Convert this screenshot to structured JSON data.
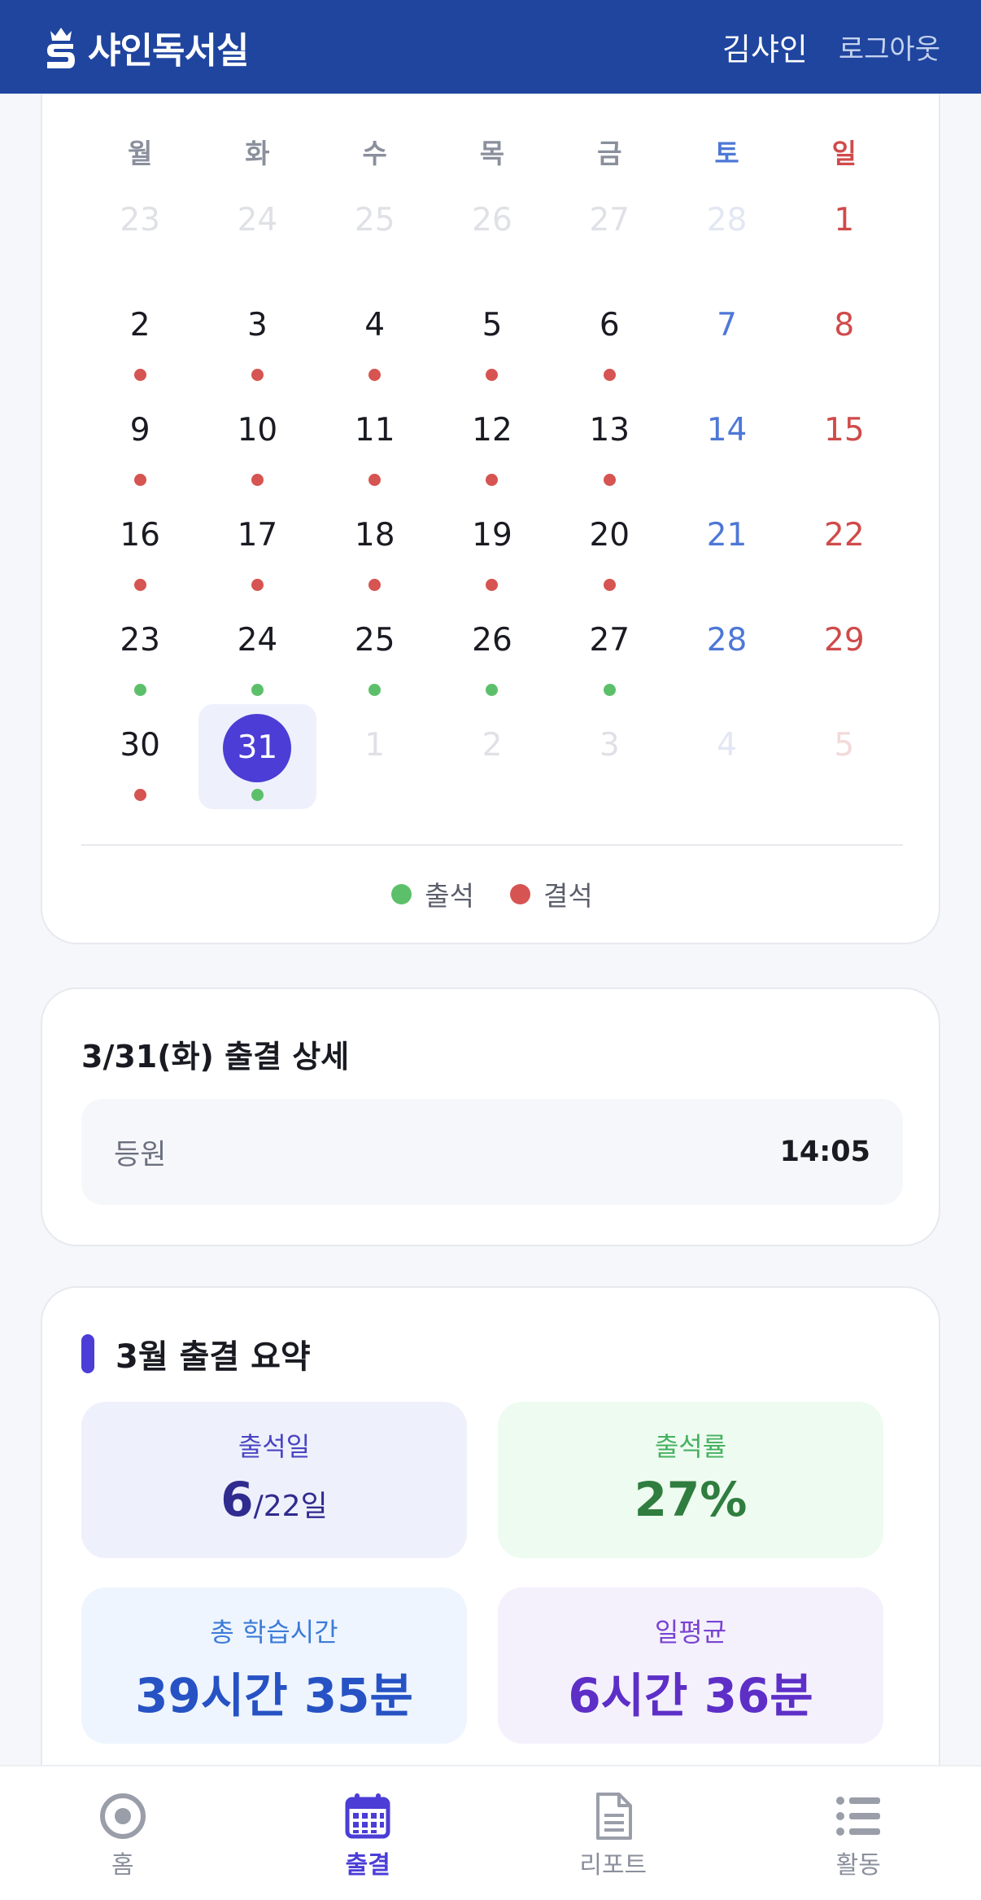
{
  "header": {
    "app_name": "샤인독서실",
    "user_name": "김샤인",
    "logout_label": "로그아웃"
  },
  "calendar": {
    "weekdays": [
      "월",
      "화",
      "수",
      "목",
      "금",
      "토",
      "일"
    ],
    "weeks": [
      [
        {
          "d": "23",
          "m": true
        },
        {
          "d": "24",
          "m": true
        },
        {
          "d": "25",
          "m": true
        },
        {
          "d": "26",
          "m": true
        },
        {
          "d": "27",
          "m": true
        },
        {
          "d": "28",
          "m": true
        },
        {
          "d": "1",
          "s": ""
        }
      ],
      [
        {
          "d": "2",
          "s": "absent"
        },
        {
          "d": "3",
          "s": "absent"
        },
        {
          "d": "4",
          "s": "absent"
        },
        {
          "d": "5",
          "s": "absent"
        },
        {
          "d": "6",
          "s": "absent"
        },
        {
          "d": "7",
          "s": ""
        },
        {
          "d": "8",
          "s": ""
        }
      ],
      [
        {
          "d": "9",
          "s": "absent"
        },
        {
          "d": "10",
          "s": "absent"
        },
        {
          "d": "11",
          "s": "absent"
        },
        {
          "d": "12",
          "s": "absent"
        },
        {
          "d": "13",
          "s": "absent"
        },
        {
          "d": "14",
          "s": ""
        },
        {
          "d": "15",
          "s": ""
        }
      ],
      [
        {
          "d": "16",
          "s": "absent"
        },
        {
          "d": "17",
          "s": "absent"
        },
        {
          "d": "18",
          "s": "absent"
        },
        {
          "d": "19",
          "s": "absent"
        },
        {
          "d": "20",
          "s": "absent"
        },
        {
          "d": "21",
          "s": ""
        },
        {
          "d": "22",
          "s": ""
        }
      ],
      [
        {
          "d": "23",
          "s": "present"
        },
        {
          "d": "24",
          "s": "present"
        },
        {
          "d": "25",
          "s": "present"
        },
        {
          "d": "26",
          "s": "present"
        },
        {
          "d": "27",
          "s": "present"
        },
        {
          "d": "28",
          "s": ""
        },
        {
          "d": "29",
          "s": ""
        }
      ],
      [
        {
          "d": "30",
          "s": "absent"
        },
        {
          "d": "31",
          "s": "present",
          "sel": true
        },
        {
          "d": "1",
          "m": true
        },
        {
          "d": "2",
          "m": true
        },
        {
          "d": "3",
          "m": true
        },
        {
          "d": "4",
          "m": true
        },
        {
          "d": "5",
          "m": true
        }
      ]
    ],
    "legend": [
      {
        "label": "출석",
        "color": "#5cc06a"
      },
      {
        "label": "결석",
        "color": "#d65451"
      }
    ]
  },
  "detail": {
    "title": "3/31(화) 출결 상세",
    "row_label": "등원",
    "row_time": "14:05"
  },
  "summary": {
    "title": "3월 출결 요약",
    "attendance_days_label": "출석일",
    "attendance_days_value": "6",
    "attendance_days_total": "/22일",
    "attendance_rate_label": "출석률",
    "attendance_rate_value": "27%",
    "total_study_label": "총 학습시간",
    "total_study_value": "39시간 35분",
    "daily_avg_label": "일평균",
    "daily_avg_value": "6시간 36분"
  },
  "nav": [
    {
      "label": "홈",
      "icon": "home-target-icon"
    },
    {
      "label": "출결",
      "icon": "calendar-icon",
      "active": true
    },
    {
      "label": "리포트",
      "icon": "document-icon"
    },
    {
      "label": "활동",
      "icon": "list-icon"
    }
  ],
  "colors": {
    "brand": "#1f459f",
    "accent": "#4b3dd6",
    "present": "#5cc06a",
    "absent": "#d65451"
  }
}
